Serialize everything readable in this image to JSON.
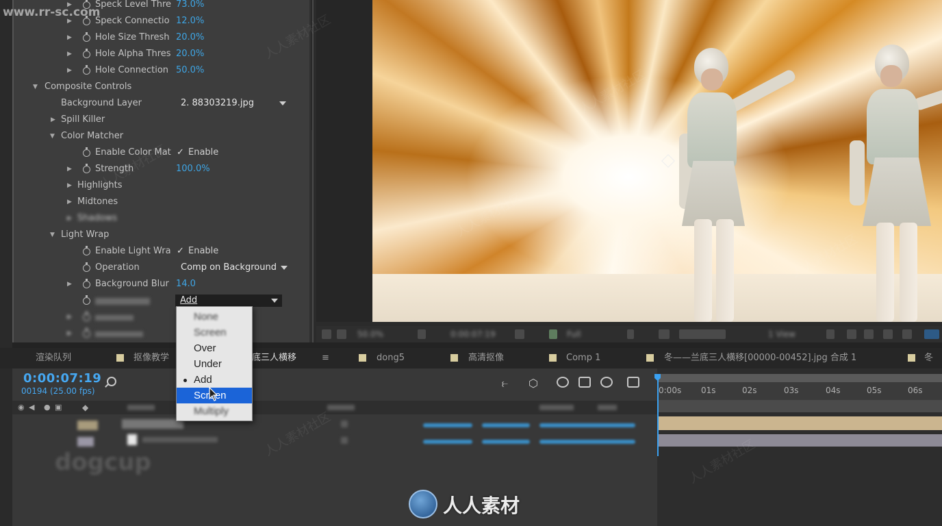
{
  "watermark": {
    "url": "www.rr-sc.com",
    "logo_text": "人人素材",
    "diag_text": "人人素材社区"
  },
  "effect_controls": {
    "rows": [
      {
        "name": "Speck Level Thre",
        "value": "73.0%"
      },
      {
        "name": "Speck Connectio",
        "value": "12.0%"
      },
      {
        "name": "Hole Size Thresh",
        "value": "20.0%"
      },
      {
        "name": "Hole Alpha Thres",
        "value": "20.0%"
      },
      {
        "name": "Hole Connection",
        "value": "50.0%"
      }
    ],
    "composite_controls": "Composite Controls",
    "background_layer_label": "Background Layer",
    "background_layer_value": "2. 88303219.jpg",
    "spill_killer": "Spill Killer",
    "color_matcher": "Color Matcher",
    "enable_color_match": "Enable Color Mat",
    "enable_label": "Enable",
    "strength_label": "Strength",
    "strength_value": "100.0%",
    "highlights": "Highlights",
    "midtones": "Midtones",
    "shadows": "Shadows",
    "light_wrap": "Light Wrap",
    "enable_light_wrap": "Enable Light Wra",
    "operation_label": "Operation",
    "operation_value": "Comp on Background",
    "background_blur_label": "Background Blur",
    "background_blur_value": "14.0",
    "blend_mode_value": "Add"
  },
  "blend_menu": {
    "items": [
      "None",
      "Screen",
      "Over",
      "Under",
      "Add",
      "Screen",
      "Multiply"
    ],
    "checked_index": 4,
    "highlighted_index": 5
  },
  "viewer_toolbar": {
    "zoom": "50.0%",
    "timecode": "0:00:07:19",
    "resolution": "Full",
    "view": "1 View"
  },
  "tabs": [
    {
      "label": "渲染队列",
      "active": false
    },
    {
      "label": "抠像教学",
      "active": false
    },
    {
      "label": "冬——兰底三人横移",
      "active": true
    },
    {
      "label": "dong5",
      "active": false
    },
    {
      "label": "高清抠像",
      "active": false
    },
    {
      "label": "Comp 1",
      "active": false
    },
    {
      "label": "冬——兰底三人横移[00000-00452].jpg 合成 1",
      "active": false
    },
    {
      "label": "冬",
      "active": false
    }
  ],
  "timeline": {
    "timecode": "0:00:07:19",
    "frames": "00194 (25.00 fps)",
    "ruler": [
      "0:00s",
      "01s",
      "02s",
      "03s",
      "04s",
      "05s",
      "06s"
    ]
  },
  "colors": {
    "accent_blue": "#3ea6e6",
    "menu_selection": "#1b64d8",
    "track1": "#cbb58f",
    "track2": "#8d8a96"
  }
}
